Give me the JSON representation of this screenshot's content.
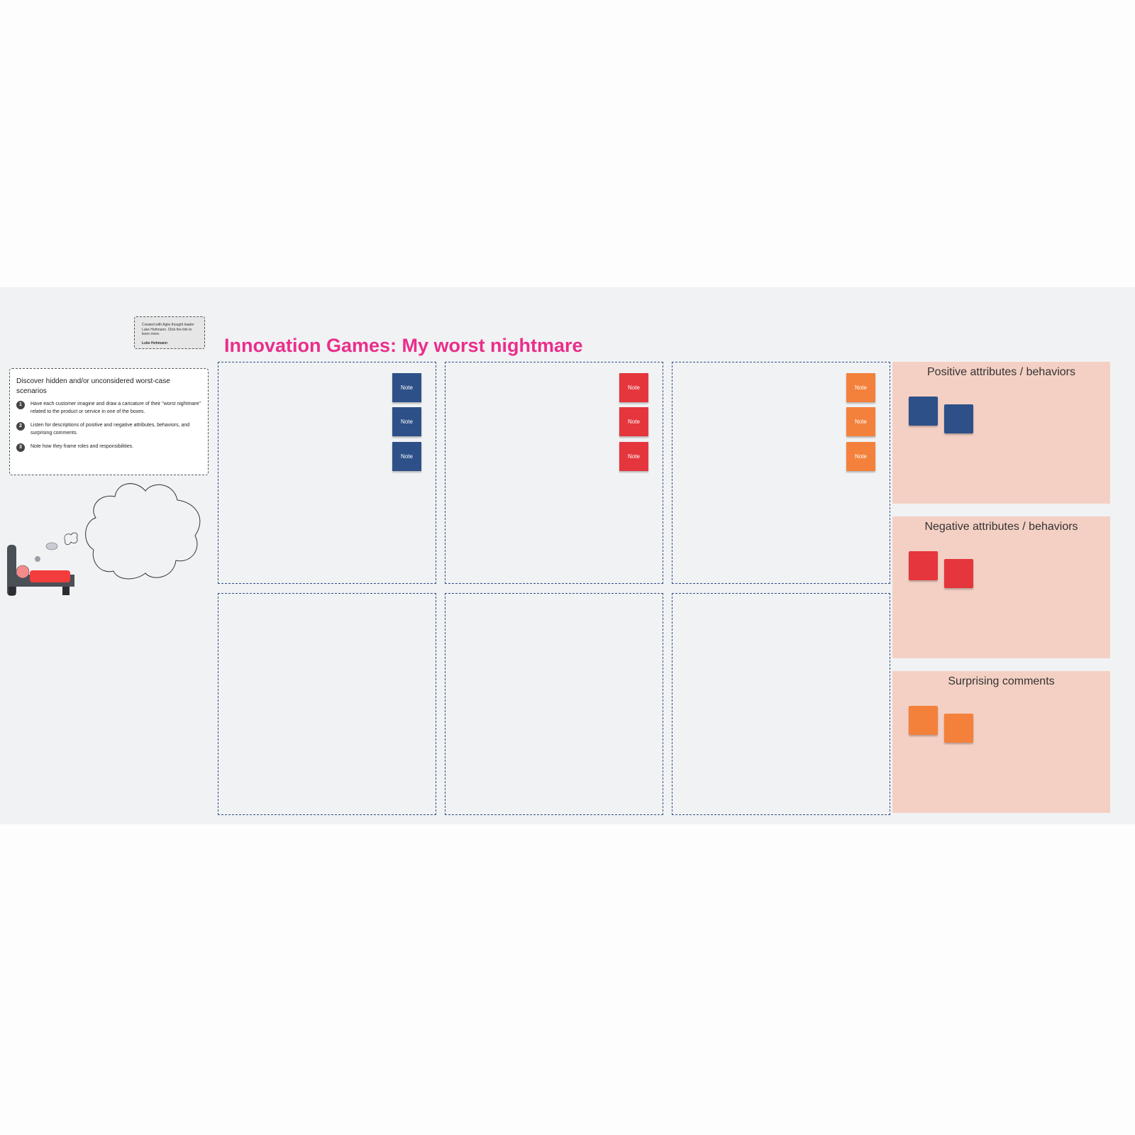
{
  "colors": {
    "blue": "#2d5088",
    "red": "#e5363d",
    "orange": "#f3813b",
    "panel": "#f4d0c4",
    "title": "#ea2e8b"
  },
  "credit": {
    "text": "Created with Agile thought leader Luke Hohmann. Click the link to learn more.",
    "author": "Luke Hohmann"
  },
  "title": "Innovation Games: My worst nightmare",
  "instructions": {
    "heading": "Discover hidden and/or unconsidered worst-case scenarios",
    "steps": [
      {
        "num": "1",
        "text": "Have each customer imagine and draw a caricature of their \"worst nightmare\" related to the product or service in one of the boxes."
      },
      {
        "num": "2",
        "text": "Listen for descriptions of positive and negative attributes, behaviors, and surprising comments."
      },
      {
        "num": "3",
        "text": "Note how they frame roles and responsibilities."
      }
    ]
  },
  "note_label": "Note",
  "panels": [
    {
      "title": "Positive attributes / behaviors",
      "color": "blue"
    },
    {
      "title": "Negative attributes / behaviors",
      "color": "red"
    },
    {
      "title": "Surprising comments",
      "color": "orange"
    }
  ]
}
